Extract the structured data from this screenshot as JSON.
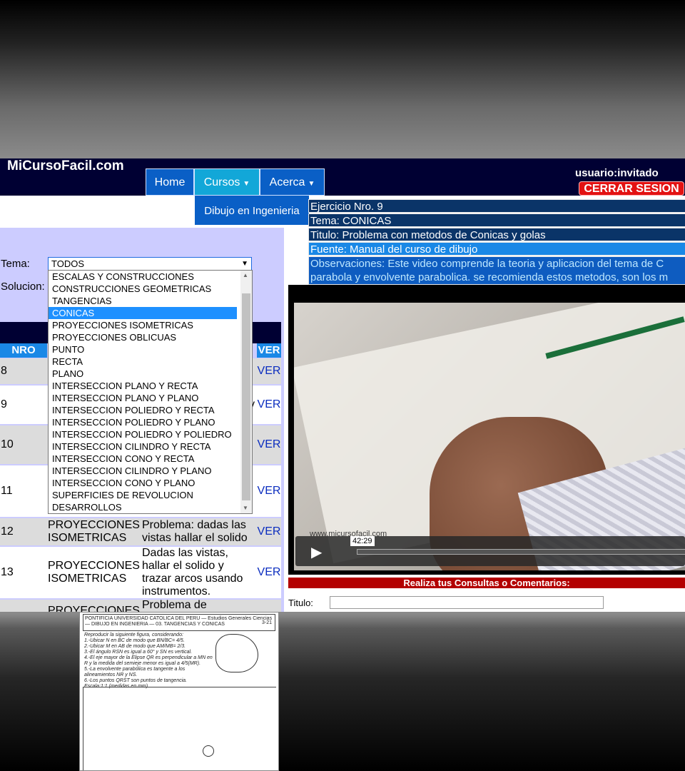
{
  "header": {
    "logo": "MiCursoFacil.com",
    "nav": [
      "Home",
      "Cursos",
      "Acerca"
    ],
    "dropdown_item": "Dibujo en Ingenieria",
    "user": "usuario:invitado",
    "logout": "CERRAR SESION"
  },
  "exercise": {
    "numero": "Ejercicio Nro. 9",
    "tema": "Tema: CONICAS",
    "titulo": "Titulo: Problema con metodos de Conicas y golas",
    "fuente": "Fuente: Manual del curso de dibujo",
    "observaciones": "Observaciones: Este video comprende la teoria y aplicacion del tema de C parabola y envolvente parabolica. se recomienda estos metodos, son los m"
  },
  "filters": {
    "tema_label": "Tema:",
    "solucion_label": "Solucion:",
    "selected": "TODOS",
    "options": [
      "ESCALAS Y CONSTRUCCIONES",
      "CONSTRUCCIONES GEOMETRICAS",
      "TANGENCIAS",
      "CONICAS",
      "PROYECCIONES ISOMETRICAS",
      "PROYECCIONES OBLICUAS",
      "PUNTO",
      "RECTA",
      "PLANO",
      "INTERSECCION PLANO Y RECTA",
      "INTERSECCION PLANO Y PLANO",
      "INTERSECCION POLIEDRO Y RECTA",
      "INTERSECCION POLIEDRO Y PLANO",
      "INTERSECCION POLIEDRO Y POLIEDRO",
      "INTERSECCION CILINDRO Y RECTA",
      "INTERSECCION CONO Y RECTA",
      "INTERSECCION CILINDRO Y PLANO",
      "INTERSECCION CONO Y PLANO",
      "SUPERFICIES DE REVOLUCION",
      "DESARROLLOS"
    ],
    "highlighted": "CONICAS"
  },
  "table": {
    "headers": {
      "nro": "NRO",
      "ver": "VER"
    },
    "rows": [
      {
        "nro": "8",
        "tema": "",
        "desc": "",
        "ver": "VER"
      },
      {
        "nro": "9",
        "tema": "",
        "desc": "y",
        "ver": "VER"
      },
      {
        "nro": "10",
        "tema": "",
        "desc": "",
        "ver": "VER"
      },
      {
        "nro": "11",
        "tema": "",
        "desc": "",
        "ver": "VER"
      },
      {
        "nro": "12",
        "tema": "PROYECCIONES ISOMETRICAS",
        "desc": "Problema: dadas las vistas hallar el solido",
        "ver": "VER"
      },
      {
        "nro": "13",
        "tema": "PROYECCIONES ISOMETRICAS",
        "desc": "Dadas las vistas, hallar el solido y trazar arcos usando instrumentos.",
        "ver": "VER"
      },
      {
        "nro": "",
        "tema": "PROYECCIONES",
        "desc": "Problema de",
        "ver": ""
      }
    ]
  },
  "video": {
    "time": "42:29",
    "watermark": "www.micursofacil.com"
  },
  "comments": {
    "bar": "Realiza tus Consultas o Comentarios:",
    "titulo_label": "Titulo:"
  },
  "sheet": {
    "header": "PONTIFICIA UNIVERSIDAD CATOLICA DEL PERU — Estudios Generales Ciencias — DIBUJO EN INGENIERIA — 03. TANGENCIAS Y CONICAS",
    "code": "3-21",
    "instructions": [
      "Reproducir la siguiente figura, considerando:",
      "1.-Ubicar N en BC de modo que BN/BC= 4/5.",
      "2.-Ubicar M en AB de modo que AM/MB= 2/3.",
      "3.-El ángulo RSN es igual a 60° y SN es vertical.",
      "4.-El eje mayor de la Elipse QR es perpendicular a MN en R y la medida del semieje menor es igual a 4/5(MR).",
      "5.-La envolvente parabólica es tangente a los alineamientos NR y NS.",
      "6.-Los puntos QRST son puntos de tangencia.",
      "Escala:1:1 (medidas en mm)"
    ]
  },
  "colors": {
    "nav_dark": "#000033",
    "nav_blue": "#0a5fc6",
    "nav_active": "#12a7d8",
    "danger": "#e31212",
    "panel": "#ccccff",
    "header_blue": "#1a88e6"
  }
}
